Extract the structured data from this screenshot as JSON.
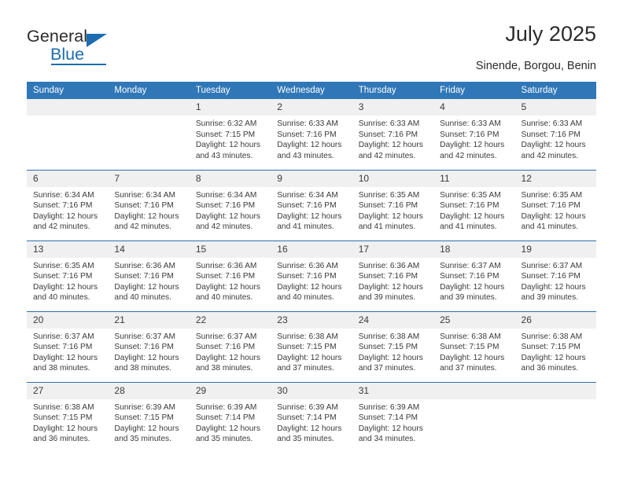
{
  "brand": {
    "name_part1": "General",
    "name_part2": "Blue",
    "triangle_icon": "triangle-icon",
    "accent_color": "#1d6cb0"
  },
  "header": {
    "title": "July 2025",
    "subtitle": "Sinende, Borgou, Benin"
  },
  "theme": {
    "header_blue": "#3077b8",
    "divider_blue": "#2f6fae",
    "daynum_band": "#f0f0f0",
    "text": "#3a3a3a"
  },
  "calendar": {
    "weekday_headers": [
      "Sunday",
      "Monday",
      "Tuesday",
      "Wednesday",
      "Thursday",
      "Friday",
      "Saturday"
    ],
    "weeks": [
      [
        {
          "day": "",
          "empty": true
        },
        {
          "day": "",
          "empty": true
        },
        {
          "day": "1",
          "sunrise": "Sunrise: 6:32 AM",
          "sunset": "Sunset: 7:15 PM",
          "daylight1": "Daylight: 12 hours",
          "daylight2": "and 43 minutes."
        },
        {
          "day": "2",
          "sunrise": "Sunrise: 6:33 AM",
          "sunset": "Sunset: 7:16 PM",
          "daylight1": "Daylight: 12 hours",
          "daylight2": "and 43 minutes."
        },
        {
          "day": "3",
          "sunrise": "Sunrise: 6:33 AM",
          "sunset": "Sunset: 7:16 PM",
          "daylight1": "Daylight: 12 hours",
          "daylight2": "and 42 minutes."
        },
        {
          "day": "4",
          "sunrise": "Sunrise: 6:33 AM",
          "sunset": "Sunset: 7:16 PM",
          "daylight1": "Daylight: 12 hours",
          "daylight2": "and 42 minutes."
        },
        {
          "day": "5",
          "sunrise": "Sunrise: 6:33 AM",
          "sunset": "Sunset: 7:16 PM",
          "daylight1": "Daylight: 12 hours",
          "daylight2": "and 42 minutes."
        }
      ],
      [
        {
          "day": "6",
          "sunrise": "Sunrise: 6:34 AM",
          "sunset": "Sunset: 7:16 PM",
          "daylight1": "Daylight: 12 hours",
          "daylight2": "and 42 minutes."
        },
        {
          "day": "7",
          "sunrise": "Sunrise: 6:34 AM",
          "sunset": "Sunset: 7:16 PM",
          "daylight1": "Daylight: 12 hours",
          "daylight2": "and 42 minutes."
        },
        {
          "day": "8",
          "sunrise": "Sunrise: 6:34 AM",
          "sunset": "Sunset: 7:16 PM",
          "daylight1": "Daylight: 12 hours",
          "daylight2": "and 42 minutes."
        },
        {
          "day": "9",
          "sunrise": "Sunrise: 6:34 AM",
          "sunset": "Sunset: 7:16 PM",
          "daylight1": "Daylight: 12 hours",
          "daylight2": "and 41 minutes."
        },
        {
          "day": "10",
          "sunrise": "Sunrise: 6:35 AM",
          "sunset": "Sunset: 7:16 PM",
          "daylight1": "Daylight: 12 hours",
          "daylight2": "and 41 minutes."
        },
        {
          "day": "11",
          "sunrise": "Sunrise: 6:35 AM",
          "sunset": "Sunset: 7:16 PM",
          "daylight1": "Daylight: 12 hours",
          "daylight2": "and 41 minutes."
        },
        {
          "day": "12",
          "sunrise": "Sunrise: 6:35 AM",
          "sunset": "Sunset: 7:16 PM",
          "daylight1": "Daylight: 12 hours",
          "daylight2": "and 41 minutes."
        }
      ],
      [
        {
          "day": "13",
          "sunrise": "Sunrise: 6:35 AM",
          "sunset": "Sunset: 7:16 PM",
          "daylight1": "Daylight: 12 hours",
          "daylight2": "and 40 minutes."
        },
        {
          "day": "14",
          "sunrise": "Sunrise: 6:36 AM",
          "sunset": "Sunset: 7:16 PM",
          "daylight1": "Daylight: 12 hours",
          "daylight2": "and 40 minutes."
        },
        {
          "day": "15",
          "sunrise": "Sunrise: 6:36 AM",
          "sunset": "Sunset: 7:16 PM",
          "daylight1": "Daylight: 12 hours",
          "daylight2": "and 40 minutes."
        },
        {
          "day": "16",
          "sunrise": "Sunrise: 6:36 AM",
          "sunset": "Sunset: 7:16 PM",
          "daylight1": "Daylight: 12 hours",
          "daylight2": "and 40 minutes."
        },
        {
          "day": "17",
          "sunrise": "Sunrise: 6:36 AM",
          "sunset": "Sunset: 7:16 PM",
          "daylight1": "Daylight: 12 hours",
          "daylight2": "and 39 minutes."
        },
        {
          "day": "18",
          "sunrise": "Sunrise: 6:37 AM",
          "sunset": "Sunset: 7:16 PM",
          "daylight1": "Daylight: 12 hours",
          "daylight2": "and 39 minutes."
        },
        {
          "day": "19",
          "sunrise": "Sunrise: 6:37 AM",
          "sunset": "Sunset: 7:16 PM",
          "daylight1": "Daylight: 12 hours",
          "daylight2": "and 39 minutes."
        }
      ],
      [
        {
          "day": "20",
          "sunrise": "Sunrise: 6:37 AM",
          "sunset": "Sunset: 7:16 PM",
          "daylight1": "Daylight: 12 hours",
          "daylight2": "and 38 minutes."
        },
        {
          "day": "21",
          "sunrise": "Sunrise: 6:37 AM",
          "sunset": "Sunset: 7:16 PM",
          "daylight1": "Daylight: 12 hours",
          "daylight2": "and 38 minutes."
        },
        {
          "day": "22",
          "sunrise": "Sunrise: 6:37 AM",
          "sunset": "Sunset: 7:16 PM",
          "daylight1": "Daylight: 12 hours",
          "daylight2": "and 38 minutes."
        },
        {
          "day": "23",
          "sunrise": "Sunrise: 6:38 AM",
          "sunset": "Sunset: 7:15 PM",
          "daylight1": "Daylight: 12 hours",
          "daylight2": "and 37 minutes."
        },
        {
          "day": "24",
          "sunrise": "Sunrise: 6:38 AM",
          "sunset": "Sunset: 7:15 PM",
          "daylight1": "Daylight: 12 hours",
          "daylight2": "and 37 minutes."
        },
        {
          "day": "25",
          "sunrise": "Sunrise: 6:38 AM",
          "sunset": "Sunset: 7:15 PM",
          "daylight1": "Daylight: 12 hours",
          "daylight2": "and 37 minutes."
        },
        {
          "day": "26",
          "sunrise": "Sunrise: 6:38 AM",
          "sunset": "Sunset: 7:15 PM",
          "daylight1": "Daylight: 12 hours",
          "daylight2": "and 36 minutes."
        }
      ],
      [
        {
          "day": "27",
          "sunrise": "Sunrise: 6:38 AM",
          "sunset": "Sunset: 7:15 PM",
          "daylight1": "Daylight: 12 hours",
          "daylight2": "and 36 minutes."
        },
        {
          "day": "28",
          "sunrise": "Sunrise: 6:39 AM",
          "sunset": "Sunset: 7:15 PM",
          "daylight1": "Daylight: 12 hours",
          "daylight2": "and 35 minutes."
        },
        {
          "day": "29",
          "sunrise": "Sunrise: 6:39 AM",
          "sunset": "Sunset: 7:14 PM",
          "daylight1": "Daylight: 12 hours",
          "daylight2": "and 35 minutes."
        },
        {
          "day": "30",
          "sunrise": "Sunrise: 6:39 AM",
          "sunset": "Sunset: 7:14 PM",
          "daylight1": "Daylight: 12 hours",
          "daylight2": "and 35 minutes."
        },
        {
          "day": "31",
          "sunrise": "Sunrise: 6:39 AM",
          "sunset": "Sunset: 7:14 PM",
          "daylight1": "Daylight: 12 hours",
          "daylight2": "and 34 minutes."
        },
        {
          "day": "",
          "empty": true
        },
        {
          "day": "",
          "empty": true
        }
      ]
    ]
  }
}
